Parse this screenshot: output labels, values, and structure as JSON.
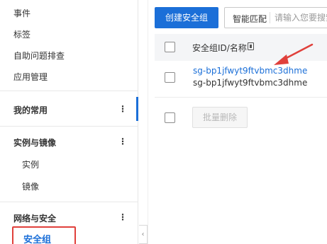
{
  "sidebar": {
    "items": [
      {
        "label": "事件"
      },
      {
        "label": "标签"
      },
      {
        "label": "自助问题排查"
      },
      {
        "label": "应用管理"
      }
    ],
    "groups": [
      {
        "label": "我的常用"
      },
      {
        "label": "实例与镜像",
        "children": [
          {
            "label": "实例"
          },
          {
            "label": "镜像"
          }
        ]
      },
      {
        "label": "网络与安全",
        "children": [
          {
            "label": "安全组"
          }
        ]
      }
    ],
    "current": "安全组",
    "collapse_glyph": "‹",
    "kebab_glyph": "⋮"
  },
  "toolbar": {
    "create_label": "创建安全组",
    "search_mode": "智能匹配",
    "search_placeholder": "请输入您要搜索"
  },
  "table": {
    "column_title": "安全组ID/名称",
    "rows": [
      {
        "id": "sg-bp1jfwyt9ftvbmc3dhme",
        "name": "sg-bp1jfwyt9ftvbmc3dhme"
      }
    ],
    "batch_delete_label": "批量删除"
  },
  "colors": {
    "accent": "#1b6fd8",
    "annotation_red": "#e0403b"
  }
}
